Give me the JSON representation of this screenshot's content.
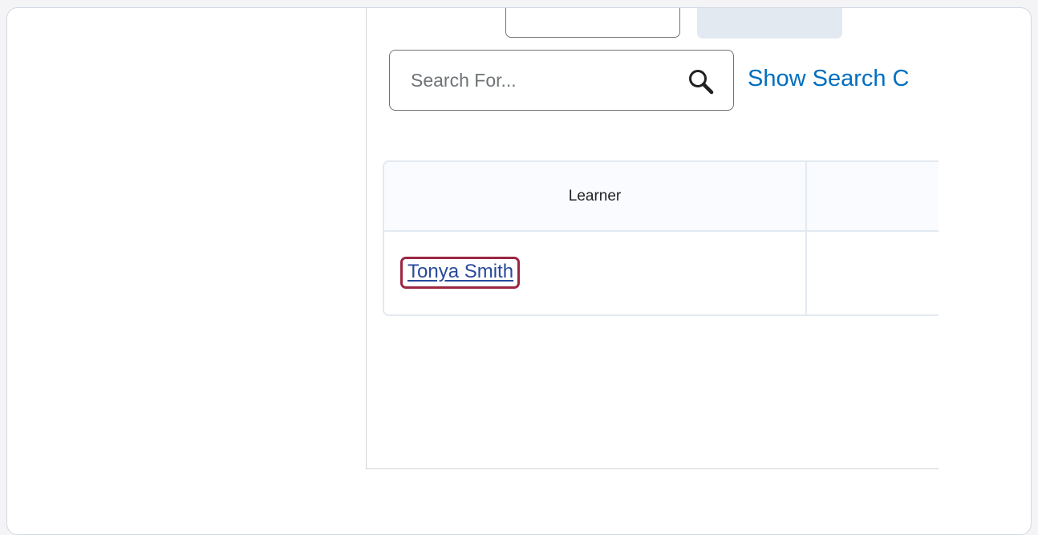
{
  "search": {
    "placeholder": "Search For...",
    "show_options_label": "Show Search C"
  },
  "table": {
    "columns": [
      "Learner",
      ""
    ],
    "rows": [
      {
        "learner": "Tonya Smith"
      }
    ]
  },
  "colors": {
    "link": "#006fbf",
    "learner_link": "#29499c",
    "highlight": "#9b2743"
  }
}
